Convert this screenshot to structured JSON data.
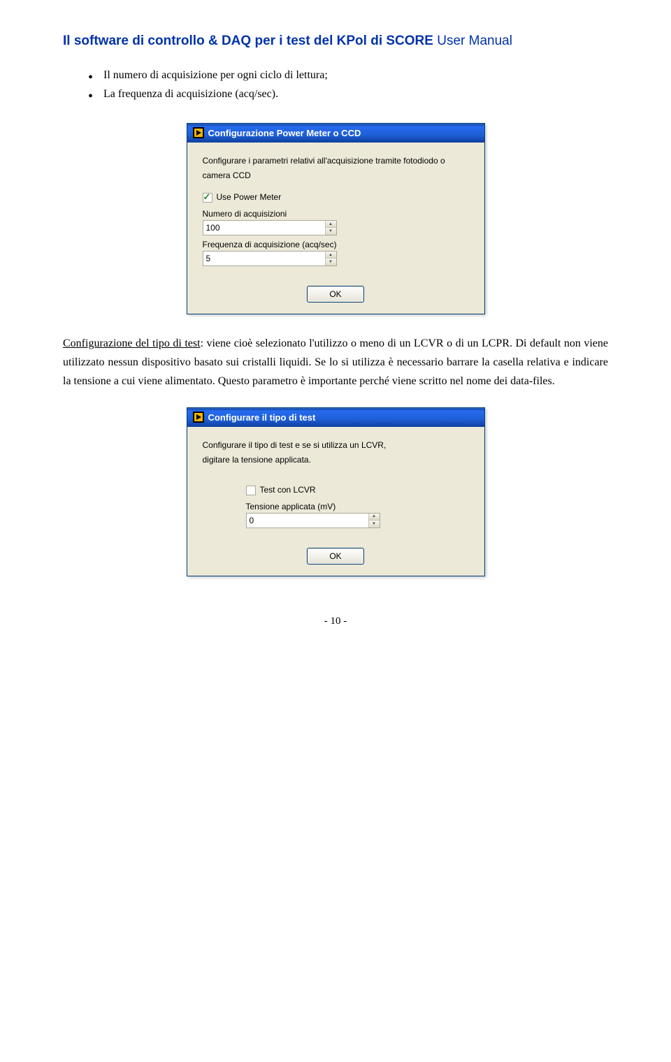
{
  "header": {
    "title_bold": "Il software di controllo & DAQ per i test del KPol di SCORE",
    "title_rest": " User Manual"
  },
  "bullets": {
    "b1": "Il numero di acquisizione per ogni ciclo di lettura;",
    "b2": "La frequenza di acquisizione (acq/sec)."
  },
  "dialog1": {
    "title": "Configurazione Power Meter o CCD",
    "desc1": "Configurare i parametri relativi all'acquisizione tramite fotodiodo o",
    "desc2": "camera CCD",
    "chk_label": "Use Power Meter",
    "lbl_num": "Numero di acquisizioni",
    "val_num": "100",
    "lbl_freq": "Frequenza di acquisizione (acq/sec)",
    "val_freq": "5",
    "ok": "OK"
  },
  "para1": {
    "link": "Configurazione del tipo di test",
    "rest": ": viene cioè selezionato l'utilizzo o meno di un LCVR o di un LCPR. Di default non viene utilizzato nessun dispositivo basato sui cristalli liquidi. Se lo si utilizza è necessario barrare la casella relativa e indicare la tensione a cui viene alimentato. Questo parametro è importante perché viene scritto nel nome dei data-files."
  },
  "dialog2": {
    "title": "Configurare il tipo di test",
    "desc1": "Configurare il tipo di test e se si utilizza un LCVR,",
    "desc2": "digitare la tensione applicata.",
    "chk_label": "Test con LCVR",
    "lbl_tension": "Tensione applicata (mV)",
    "val_tension": "0",
    "ok": "OK"
  },
  "footer": {
    "pagenum": "- 10 -"
  }
}
